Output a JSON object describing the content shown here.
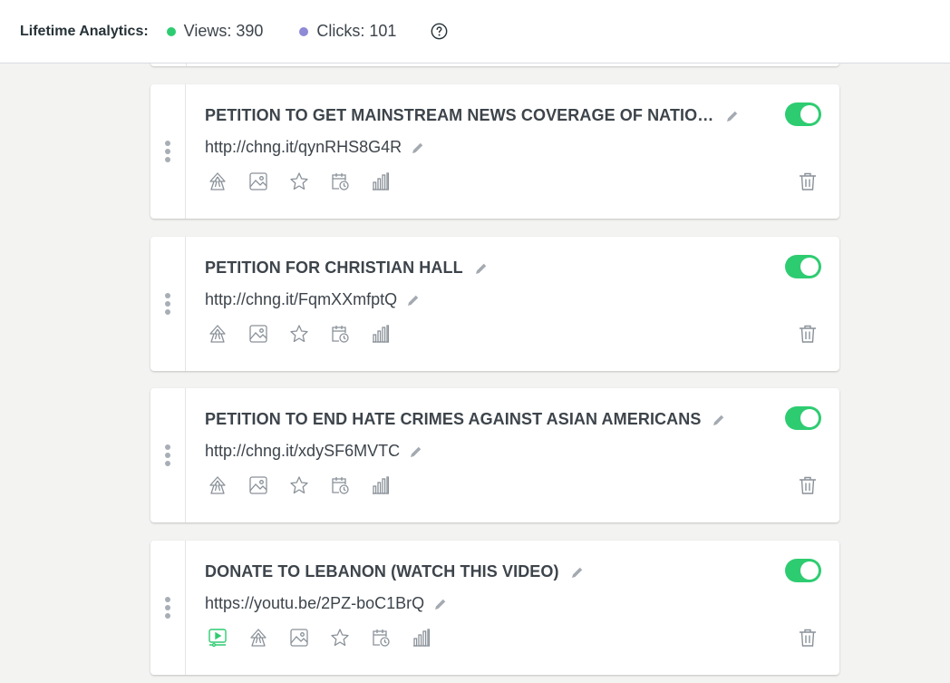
{
  "analytics": {
    "label": "Lifetime Analytics:",
    "views": "Views: 390",
    "clicks": "Clicks: 101",
    "views_color": "#2ecc71",
    "clicks_color": "#8e8ad6"
  },
  "colors": {
    "accent": "#2ecc71",
    "icon": "#8a9199",
    "text": "#3d444b"
  },
  "links": [
    {
      "title": "PETITION TO GET MAINSTREAM NEWS COVERAGE OF NATIONAL PROTESTS",
      "url": "http://chng.it/qynRHS8G4R",
      "enabled": true,
      "icons": [
        "priority-icon",
        "thumbnail-icon",
        "favorite-icon",
        "schedule-icon",
        "analytics-icon"
      ]
    },
    {
      "title": "PETITION FOR CHRISTIAN HALL",
      "url": "http://chng.it/FqmXXmfptQ",
      "enabled": true,
      "icons": [
        "priority-icon",
        "thumbnail-icon",
        "favorite-icon",
        "schedule-icon",
        "analytics-icon"
      ]
    },
    {
      "title": "PETITION TO END HATE CRIMES AGAINST ASIAN AMERICANS",
      "url": "http://chng.it/xdySF6MVTC",
      "enabled": true,
      "icons": [
        "priority-icon",
        "thumbnail-icon",
        "favorite-icon",
        "schedule-icon",
        "analytics-icon"
      ]
    },
    {
      "title": "DONATE TO LEBANON (WATCH THIS VIDEO)",
      "url": "https://youtu.be/2PZ-boC1BrQ",
      "enabled": true,
      "icons": [
        "video-embed-icon",
        "priority-icon",
        "thumbnail-icon",
        "favorite-icon",
        "schedule-icon",
        "analytics-icon"
      ]
    }
  ]
}
